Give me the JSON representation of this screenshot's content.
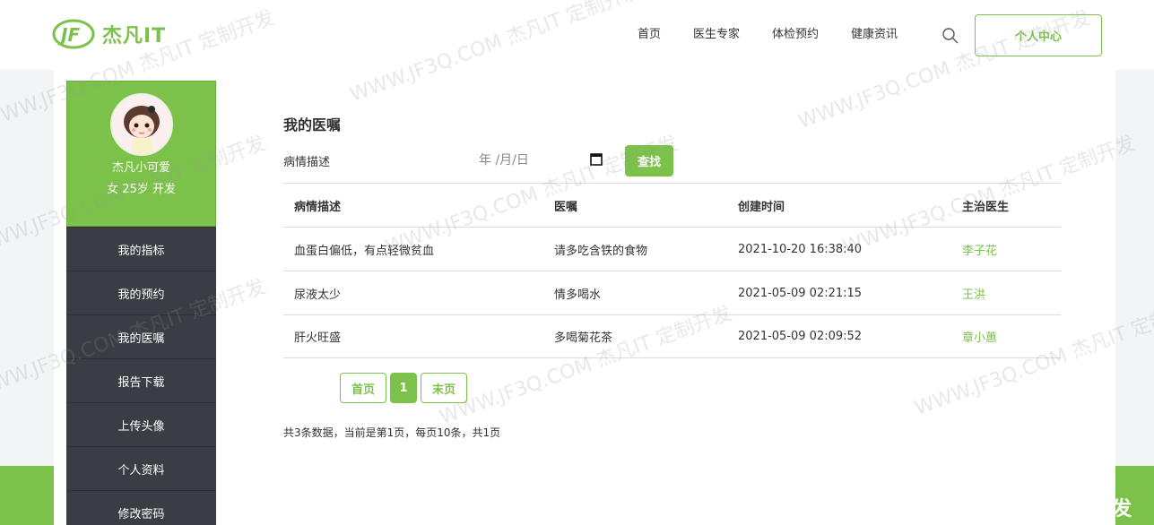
{
  "header": {
    "logo_text": "杰凡IT",
    "nav": [
      "首页",
      "医生专家",
      "体检预约",
      "健康资讯"
    ],
    "user_center": "个人中心"
  },
  "sidebar": {
    "username": "杰凡小可爱",
    "user_info": "女 25岁 开发",
    "items": [
      "我的指标",
      "我的预约",
      "我的医嘱",
      "报告下载",
      "上传头像",
      "个人资料",
      "修改密码"
    ]
  },
  "main": {
    "title": "我的医嘱",
    "filter_label": "病情描述",
    "date_placeholder": "年 /月/日",
    "search_button": "查找",
    "table": {
      "headers": [
        "病情描述",
        "医嘱",
        "创建时间",
        "主治医生"
      ],
      "rows": [
        [
          "血蛋白偏低，有点轻微贫血",
          "请多吃含铁的食物",
          "2021-10-20 16:38:40",
          "李子花"
        ],
        [
          "尿液太少",
          "情多喝水",
          "2021-05-09 02:21:15",
          "王洪"
        ],
        [
          "肝火旺盛",
          "多喝菊花茶",
          "2021-05-09 02:09:52",
          "章小蕙"
        ]
      ]
    },
    "pager": {
      "first": "首页",
      "current": "1",
      "last": "末页"
    },
    "summary": "共3条数据，当前是第1页，每页10条，共1页"
  },
  "watermark": {
    "text": "WWW.JF3Q.COM 杰凡IT 定制开发",
    "bottom_text": "WWW.JF3Q.COM 杰凡IT  定制开发"
  },
  "colors": {
    "accent": "#7cc24a",
    "sidebar_dark": "#3a3d44"
  }
}
